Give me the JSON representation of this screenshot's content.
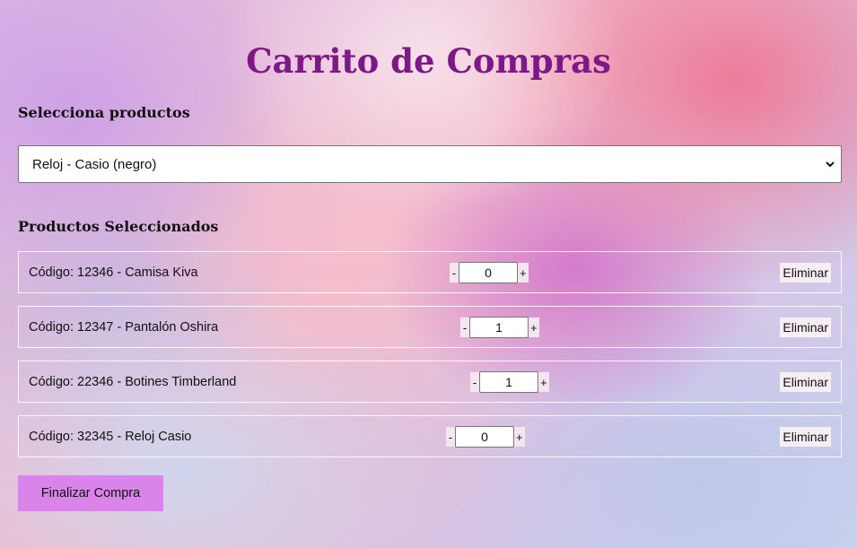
{
  "page": {
    "title": "Carrito de Compras"
  },
  "selector": {
    "label": "Selecciona productos",
    "selected": "Reloj - Casio (negro)",
    "icon": "chevron-down-icon"
  },
  "cart": {
    "heading": "Productos Seleccionados",
    "items": [
      {
        "text": "Código: 12346 - Camisa Kiva",
        "qty": "0",
        "minus": "-",
        "plus": "+",
        "remove": "Eliminar"
      },
      {
        "text": "Código: 12347 - Pantalón Oshira",
        "qty": "1",
        "minus": "-",
        "plus": "+",
        "remove": "Eliminar"
      },
      {
        "text": "Código: 22346 - Botines Timberland",
        "qty": "1",
        "minus": "-",
        "plus": "+",
        "remove": "Eliminar"
      },
      {
        "text": "Código: 32345 - Reloj Casio",
        "qty": "0",
        "minus": "-",
        "plus": "+",
        "remove": "Eliminar"
      }
    ]
  },
  "actions": {
    "finalize": "Finalizar Compra"
  },
  "colors": {
    "title": "#7d1886",
    "finalize_bg": "#d884e8"
  }
}
